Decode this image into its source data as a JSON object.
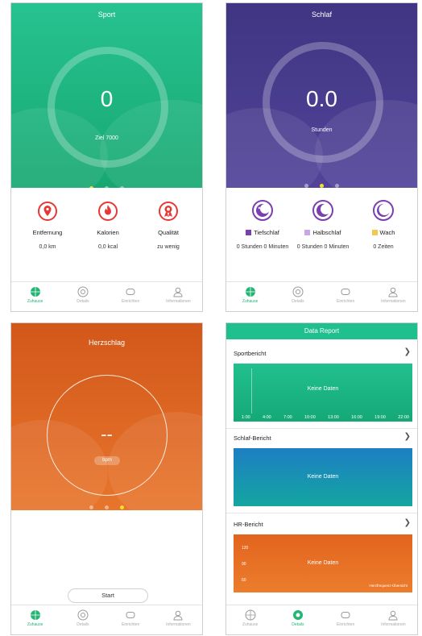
{
  "sport": {
    "title": "Sport",
    "value": "0",
    "goal": "Ziel 7000",
    "stats": [
      {
        "label": "Entfernung",
        "value": "0,0 km"
      },
      {
        "label": "Kalorien",
        "value": "0,0 kcal"
      },
      {
        "label": "Qualität",
        "value": "zu wenig"
      }
    ]
  },
  "sleep": {
    "title": "Schlaf",
    "value": "0.0",
    "unit": "Stunden",
    "stats": [
      {
        "label": "Tiefschlaf",
        "value": "0 Stunden 0 Minuten"
      },
      {
        "label": "Halbschlaf",
        "value": "0 Stunden 0 Minuten"
      },
      {
        "label": "Wach",
        "value": "0 Zeiten"
      }
    ]
  },
  "heart": {
    "title": "Herzschlag",
    "value": "--",
    "unit": "bpm",
    "start_label": "Start"
  },
  "report": {
    "title": "Data Report",
    "sport_title": "Sportbericht",
    "sleep_title": "Schlaf-Bericht",
    "hr_title": "HR-Bericht",
    "no_data": "Keine Daten",
    "time_ticks": [
      "1:00",
      "4:00",
      "7:00",
      "10:00",
      "13:00",
      "16:00",
      "19:00",
      "22:00"
    ],
    "hr_ticks": [
      "120",
      "90",
      "60"
    ],
    "hr_note": "Herzfrequenz-Übersicht"
  },
  "nav": {
    "home": "Zuhause",
    "details": "Details",
    "settings": "Einrichten",
    "info": "Informationen"
  },
  "colors": {
    "sport": "#1dbb82",
    "sleep": "#4a3e8c",
    "heart": "#e0641e",
    "report_accent": "#1fbf8e",
    "active_dot": "#f4df2a",
    "sport_icon": "#e53935",
    "sleep_icon": "#7b3fb0"
  },
  "carousel": {
    "sport_active_page": 1,
    "sleep_active_page": 2,
    "heart_active_page": 3
  }
}
